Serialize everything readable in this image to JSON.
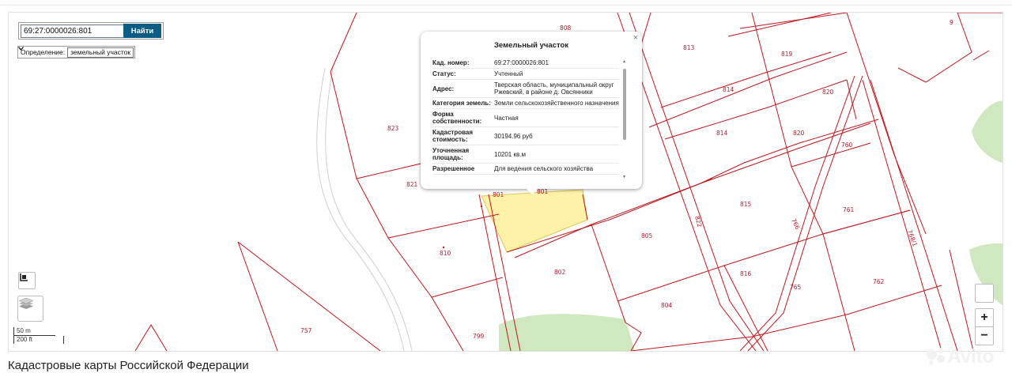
{
  "search": {
    "value": "69:27:0000026:801",
    "button_label": "Найти"
  },
  "definition": {
    "label": "Определение:",
    "selected": "земельный участок"
  },
  "popup": {
    "title": "Земельный участок",
    "close": "×",
    "rows": [
      {
        "key": "Кад. номер:",
        "value": "69:27:0000026:801"
      },
      {
        "key": "Статус:",
        "value": "Учтенный"
      },
      {
        "key": "Адрес:",
        "value": "Тверская область, муниципальный округ Ржевский, в районе д. Овсянники"
      },
      {
        "key": "Категория земель:",
        "value": "Земли сельскохозяйственного назначения"
      },
      {
        "key": "Форма собственности:",
        "value": "Частная"
      },
      {
        "key": "Кадастровая стоимость:",
        "value": "30194.96 руб"
      },
      {
        "key": "Уточненная площадь:",
        "value": "10201 кв.м"
      },
      {
        "key": "Разрешенное",
        "value": "Для ведения сельского хозяйства"
      }
    ]
  },
  "parcels": {
    "p9": "9",
    "p808": "808",
    "p813": "813",
    "p819": "819",
    "p820a": "820",
    "p814a": "814",
    "p814b": "814",
    "p820b": "820",
    "p760": "760",
    "p823": "823",
    "p821": "821",
    "p801a": "801",
    "p801b": "801",
    "p815": "815",
    "p761": "761",
    "p810": "810",
    "p805": "805",
    "p802": "802",
    "p816": "816",
    "p765": "765",
    "p762": "762",
    "p804": "804",
    "p757": "757",
    "p799": "799",
    "p822": "822",
    "p766": "766",
    "p768": "768/1"
  },
  "scale": {
    "meters": "50 m",
    "feet": "200 ft"
  },
  "zoom": {
    "in": "+",
    "out": "−"
  },
  "footer": {
    "title": "Кадастровые карты Российской Федерации"
  },
  "watermark": {
    "text": "Avito"
  },
  "colors": {
    "boundary": "#c4161c",
    "selected_parcel": "#fdf2a8",
    "green_area": "#cfe8c0",
    "button": "#0c5c86"
  }
}
